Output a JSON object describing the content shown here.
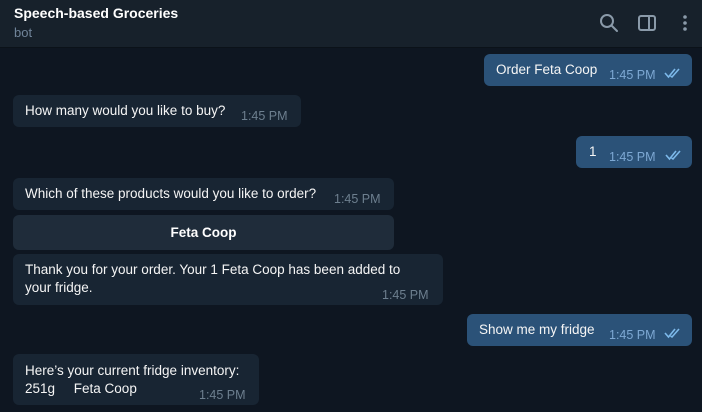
{
  "header": {
    "title": "Speech-based Groceries",
    "subtitle": "bot",
    "icons": [
      "search-icon",
      "sidebar-toggle-icon",
      "more-vertical-icon"
    ]
  },
  "messages": [
    {
      "direction": "outgoing",
      "text": "Order Feta Coop",
      "time": "1:45 PM",
      "status": "read"
    },
    {
      "direction": "incoming",
      "text": "How many would you like to buy?",
      "time": "1:45 PM"
    },
    {
      "direction": "outgoing",
      "text": "1",
      "time": "1:45 PM",
      "status": "read"
    },
    {
      "direction": "incoming",
      "text": "Which of these products would you like to order?",
      "time": "1:45 PM"
    },
    {
      "direction": "incoming",
      "lines": [
        "Thank you for your order. Your 1 Feta Coop has been added to",
        "your fridge."
      ],
      "time": "1:45 PM"
    },
    {
      "direction": "outgoing",
      "text": "Show me my fridge",
      "time": "1:45 PM",
      "status": "read"
    },
    {
      "direction": "incoming",
      "lines": [
        "Here’s your current fridge inventory:",
        "251g     Feta Coop"
      ],
      "time": "1:45 PM"
    }
  ],
  "inline_keyboard": {
    "buttons": [
      "Feta Coop"
    ]
  },
  "colors": {
    "background": "#0e1621",
    "header": "#17212b",
    "incoming_bubble": "#182533",
    "outgoing_bubble": "#2b5278",
    "read_check": "#7db9ea"
  }
}
